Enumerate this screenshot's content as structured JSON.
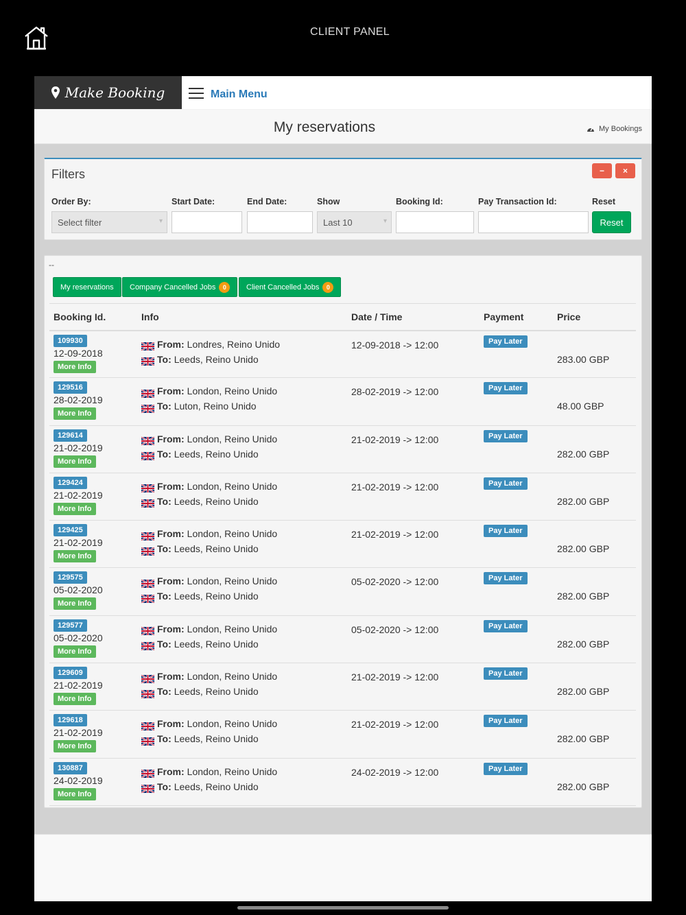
{
  "topbar": {
    "title": "CLIENT PANEL",
    "home_icon": "home-icon"
  },
  "navbar": {
    "make_booking": "Make Booking",
    "main_menu": "Main Menu"
  },
  "page": {
    "title": "My reservations",
    "breadcrumb": "My Bookings"
  },
  "filters": {
    "title": "Filters",
    "order_by_label": "Order By:",
    "order_by_value": "Select filter",
    "start_date_label": "Start Date:",
    "end_date_label": "End Date:",
    "show_label": "Show",
    "show_value": "Last 10",
    "booking_id_label": "Booking Id:",
    "pay_tx_label": "Pay Transaction Id:",
    "reset_label": "Reset",
    "reset_button": "Reset",
    "collapse_icon": "−",
    "close_icon": "×"
  },
  "list": {
    "dash": "--",
    "tabs": [
      {
        "label": "My reservations"
      },
      {
        "label": "Company Cancelled Jobs",
        "count": "0"
      },
      {
        "label": "Client Cancelled Jobs",
        "count": "0"
      }
    ],
    "headers": [
      "Booking Id.",
      "Info",
      "Date / Time",
      "Payment",
      "Price"
    ],
    "from_label": "From:",
    "to_label": "To:",
    "more_info": "More Info",
    "rows": [
      {
        "id": "109930",
        "date": "12-09-2018",
        "from": "Londres, Reino Unido",
        "to": "Leeds, Reino Unido",
        "datetime": "12-09-2018 -> 12:00",
        "payment": "Pay Later",
        "price": "283.00 GBP"
      },
      {
        "id": "129516",
        "date": "28-02-2019",
        "from": "London, Reino Unido",
        "to": "Luton, Reino Unido",
        "datetime": "28-02-2019 -> 12:00",
        "payment": "Pay Later",
        "price": "48.00 GBP"
      },
      {
        "id": "129614",
        "date": "21-02-2019",
        "from": "London, Reino Unido",
        "to": "Leeds, Reino Unido",
        "datetime": "21-02-2019 -> 12:00",
        "payment": "Pay Later",
        "price": "282.00 GBP"
      },
      {
        "id": "129424",
        "date": "21-02-2019",
        "from": "London, Reino Unido",
        "to": "Leeds, Reino Unido",
        "datetime": "21-02-2019 -> 12:00",
        "payment": "Pay Later",
        "price": "282.00 GBP"
      },
      {
        "id": "129425",
        "date": "21-02-2019",
        "from": "London, Reino Unido",
        "to": "Leeds, Reino Unido",
        "datetime": "21-02-2019 -> 12:00",
        "payment": "Pay Later",
        "price": "282.00 GBP"
      },
      {
        "id": "129575",
        "date": "05-02-2020",
        "from": "London, Reino Unido",
        "to": "Leeds, Reino Unido",
        "datetime": "05-02-2020 -> 12:00",
        "payment": "Pay Later",
        "price": "282.00 GBP"
      },
      {
        "id": "129577",
        "date": "05-02-2020",
        "from": "London, Reino Unido",
        "to": "Leeds, Reino Unido",
        "datetime": "05-02-2020 -> 12:00",
        "payment": "Pay Later",
        "price": "282.00 GBP"
      },
      {
        "id": "129609",
        "date": "21-02-2019",
        "from": "London, Reino Unido",
        "to": "Leeds, Reino Unido",
        "datetime": "21-02-2019 -> 12:00",
        "payment": "Pay Later",
        "price": "282.00 GBP"
      },
      {
        "id": "129618",
        "date": "21-02-2019",
        "from": "London, Reino Unido",
        "to": "Leeds, Reino Unido",
        "datetime": "21-02-2019 -> 12:00",
        "payment": "Pay Later",
        "price": "282.00 GBP"
      },
      {
        "id": "130887",
        "date": "24-02-2019",
        "from": "London, Reino Unido",
        "to": "Leeds, Reino Unido",
        "datetime": "24-02-2019 -> 12:00",
        "payment": "Pay Later",
        "price": "282.00 GBP"
      }
    ]
  },
  "colors": {
    "primary": "#3c8dbc",
    "success": "#00a65a",
    "more_info": "#5cb85c",
    "danger": "#e8604c",
    "badge": "#f39c12"
  }
}
